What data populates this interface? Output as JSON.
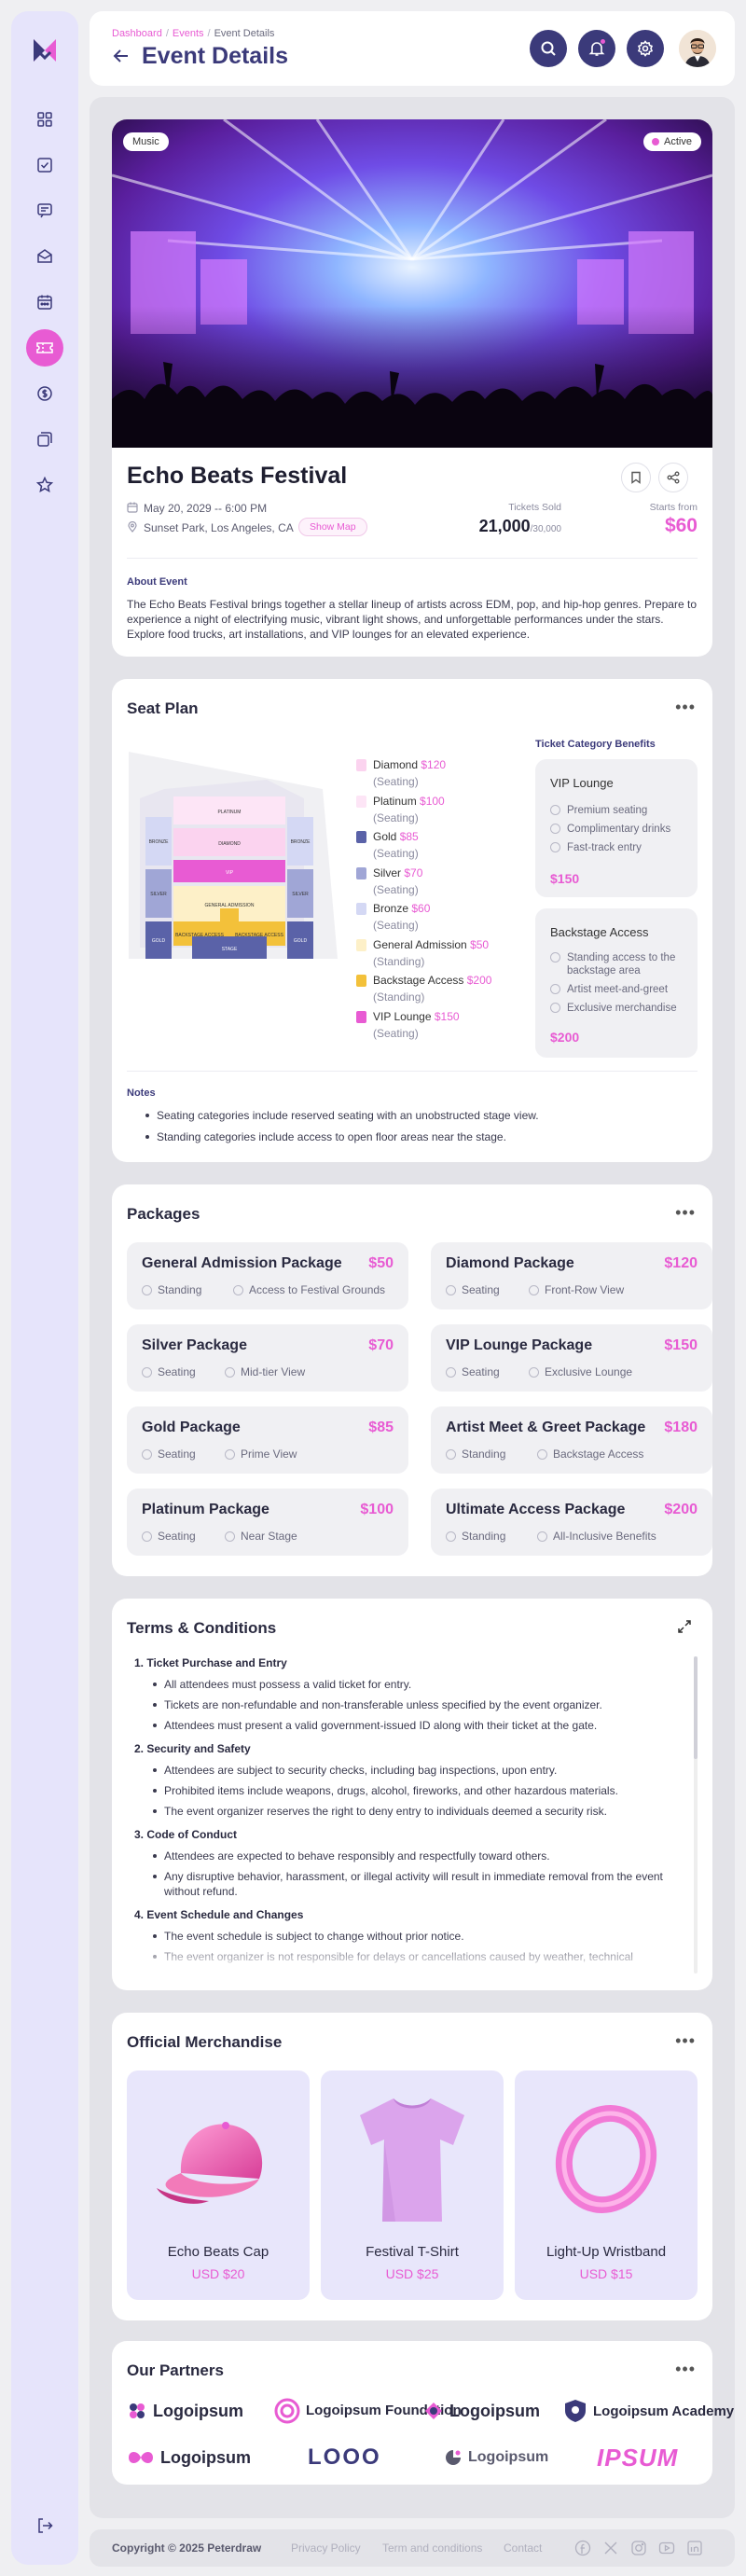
{
  "breadcrumb": {
    "items": [
      "Dashboard",
      "Events",
      "Event Details"
    ]
  },
  "page_title": "Event Details",
  "colors": {
    "accent": "#e85bd3",
    "primary": "#3b3a7a"
  },
  "sidebar": {
    "items": [
      "dashboard-icon",
      "tasks-icon",
      "messages-icon",
      "inbox-icon",
      "calendar-icon",
      "tickets-icon",
      "finance-icon",
      "gallery-icon",
      "favorites-icon"
    ],
    "active": "tickets-icon"
  },
  "event": {
    "category_badge": "Music",
    "status_badge": "Active",
    "title": "Echo Beats Festival",
    "datetime": "May 20, 2029 -- 6:00 PM",
    "location": "Sunset Park, Los Angeles, CA",
    "show_map": "Show Map",
    "tickets_sold_label": "Tickets Sold",
    "tickets_sold": "21,000",
    "tickets_total": "/30,000",
    "starts_from_label": "Starts from",
    "starts_from": "$60",
    "about_heading": "About Event",
    "about_text": "The Echo Beats Festival brings together a stellar lineup of artists across EDM, pop, and hip-hop genres. Prepare to experience a night of electrifying music, vibrant light shows, and unforgettable performances under the stars. Explore food trucks, art installations, and VIP lounges for an elevated experience."
  },
  "seat_plan": {
    "title": "Seat Plan",
    "map_labels": {
      "platinum": "PLATINUM",
      "diamond": "DIAMOND",
      "vip": "VIP",
      "general": "GENERAL ADMISSION",
      "backstage": "BACKSTAGE ACCESS",
      "bronze": "BRONZE",
      "silver": "SILVER",
      "gold": "GOLD",
      "stage": "STAGE"
    },
    "legend": [
      {
        "name": "Diamond",
        "price": "$120",
        "type": "(Seating)",
        "color": "#fbd3ef"
      },
      {
        "name": "Platinum",
        "price": "$100",
        "type": "(Seating)",
        "color": "#fde5f6"
      },
      {
        "name": "Gold",
        "price": "$85",
        "type": "(Seating)",
        "color": "#5a62a8"
      },
      {
        "name": "Silver",
        "price": "$70",
        "type": "(Seating)",
        "color": "#a0a6d6"
      },
      {
        "name": "Bronze",
        "price": "$60",
        "type": "(Seating)",
        "color": "#d4d8f4"
      },
      {
        "name": "General Admission",
        "price": "$50",
        "type": "(Standing)",
        "color": "#fdf0c8"
      },
      {
        "name": "Backstage Access",
        "price": "$200",
        "type": "(Standing)",
        "color": "#f3c13a"
      },
      {
        "name": "VIP Lounge",
        "price": "$150",
        "type": "(Seating)",
        "color": "#e85bd3"
      }
    ],
    "benefits_heading": "Ticket Category Benefits",
    "benefits": [
      {
        "name": "VIP Lounge",
        "items": [
          "Premium seating",
          "Complimentary drinks",
          "Fast-track entry"
        ],
        "price": "$150"
      },
      {
        "name": "Backstage Access",
        "items": [
          "Standing access to the backstage area",
          "Artist meet-and-greet",
          "Exclusive merchandise"
        ],
        "price": "$200"
      }
    ],
    "notes_heading": "Notes",
    "notes": [
      "Seating categories include reserved seating with an unobstructed stage view.",
      "Standing categories include access to open floor areas near the stage."
    ]
  },
  "packages": {
    "title": "Packages",
    "items": [
      {
        "name": "General Admission Package",
        "price": "$50",
        "f1": "Standing",
        "f2": "Access to Festival Grounds"
      },
      {
        "name": "Diamond Package",
        "price": "$120",
        "f1": "Seating",
        "f2": "Front-Row View"
      },
      {
        "name": "Silver Package",
        "price": "$70",
        "f1": "Seating",
        "f2": "Mid-tier View"
      },
      {
        "name": "VIP Lounge Package",
        "price": "$150",
        "f1": "Seating",
        "f2": "Exclusive Lounge"
      },
      {
        "name": "Gold Package",
        "price": "$85",
        "f1": "Seating",
        "f2": "Prime View"
      },
      {
        "name": "Artist Meet & Greet Package",
        "price": "$180",
        "f1": "Standing",
        "f2": "Backstage Access"
      },
      {
        "name": "Platinum Package",
        "price": "$100",
        "f1": "Seating",
        "f2": "Near Stage"
      },
      {
        "name": "Ultimate Access Package",
        "price": "$200",
        "f1": "Standing",
        "f2": "All-Inclusive Benefits"
      }
    ]
  },
  "terms": {
    "title": "Terms & Conditions",
    "sections": [
      {
        "heading": "1.  Ticket Purchase and Entry",
        "items": [
          "All attendees must possess a valid ticket for entry.",
          "Tickets are non-refundable and non-transferable unless specified by the event organizer.",
          "Attendees must present a valid government-issued ID along with their ticket at the gate."
        ]
      },
      {
        "heading": "2.  Security and Safety",
        "items": [
          "Attendees are subject to security checks, including bag inspections, upon entry.",
          "Prohibited items include weapons, drugs, alcohol, fireworks, and other hazardous materials.",
          "The event organizer reserves the right to deny entry to individuals deemed a security risk."
        ]
      },
      {
        "heading": "3.  Code of Conduct",
        "items": [
          "Attendees are expected to behave responsibly and respectfully toward others.",
          "Any disruptive behavior, harassment, or illegal activity will result in immediate removal from the event without refund."
        ]
      },
      {
        "heading": "4.  Event Schedule and Changes",
        "items": [
          "The event schedule is subject to change without prior notice.",
          "The event organizer is not responsible for delays or cancellations caused by weather, technical"
        ]
      }
    ]
  },
  "merchandise": {
    "title": "Official Merchandise",
    "items": [
      {
        "name": "Echo Beats Cap",
        "price": "USD $20"
      },
      {
        "name": "Festival T-Shirt",
        "price": "USD $25"
      },
      {
        "name": "Light-Up Wristband",
        "price": "USD $15"
      }
    ]
  },
  "partners": {
    "title": "Our Partners",
    "logos": [
      "Logoipsum",
      "Logoipsum Foundation",
      "Logoipsum",
      "Logoipsum Academy",
      "Logoipsum",
      "LOOO",
      "Logoipsum",
      "IPSUM"
    ]
  },
  "footer": {
    "copyright": "Copyright © 2025 Peterdraw",
    "links": [
      "Privacy Policy",
      "Term and conditions",
      "Contact"
    ],
    "social": [
      "facebook-icon",
      "x-icon",
      "instagram-icon",
      "youtube-icon",
      "linkedin-icon"
    ]
  }
}
